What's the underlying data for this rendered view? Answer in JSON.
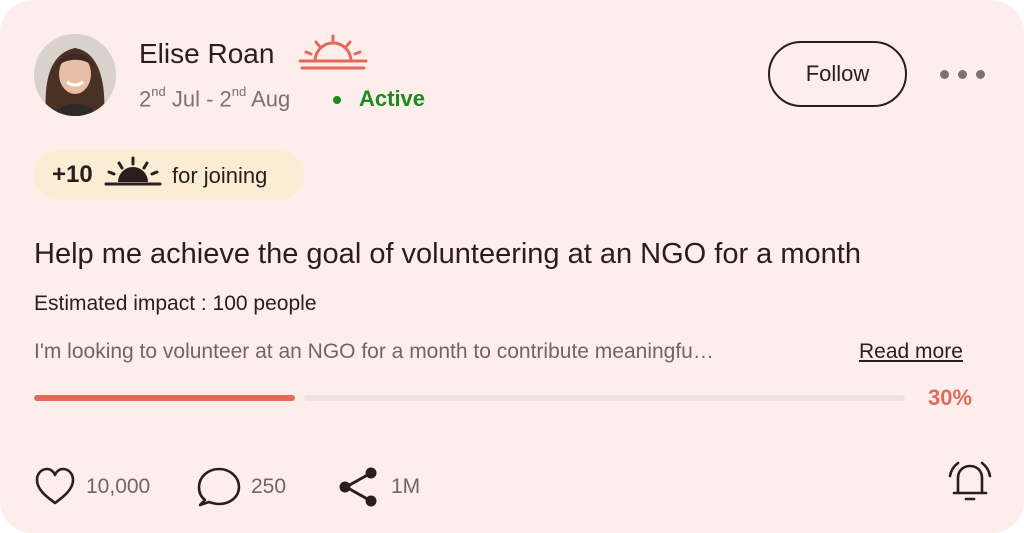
{
  "user": {
    "name": "Elise Roan",
    "date_start_day": "2",
    "date_start_suffix": "nd",
    "date_start_rest": " Jul - ",
    "date_end_day": "2",
    "date_end_suffix": "nd",
    "date_end_rest": " Aug",
    "status": "Active"
  },
  "actions": {
    "follow_label": "Follow",
    "more_icon": "more-horizontal-icon"
  },
  "reward": {
    "points": "+10",
    "text": "for joining",
    "icon": "sunrise-icon"
  },
  "goal": {
    "title": "Help me achieve the goal of volunteering at an NGO for a month",
    "impact": "Estimated impact : 100 people",
    "description": "I'm looking to volunteer at an NGO for a month to contribute meaningfu…",
    "read_more": "Read more",
    "progress_percent": 30,
    "progress_label": "30%"
  },
  "stats": {
    "likes": "10,000",
    "comments": "250",
    "shares": "1M"
  },
  "colors": {
    "accent": "#e26a5a",
    "active": "#1f8a1f",
    "card_bg": "#fdeeec",
    "reward_bg": "#fbedd3",
    "text": "#2a1d1d"
  }
}
